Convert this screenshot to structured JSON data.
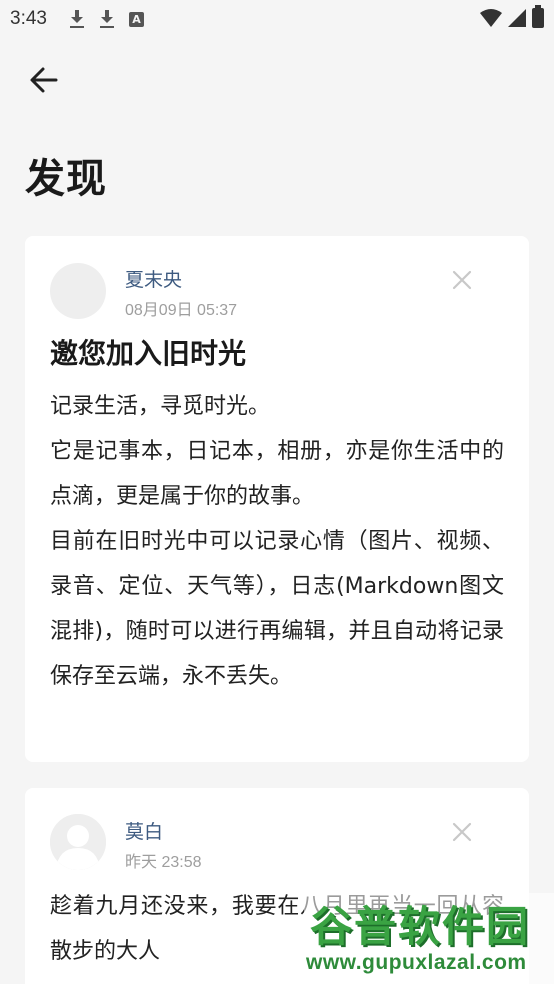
{
  "status_bar": {
    "time": "3:43",
    "left_icons": [
      "download-icon",
      "download-icon",
      "a-icon"
    ],
    "a_icon_letter": "A",
    "right_icons": [
      "wifi-icon",
      "signal-icon",
      "battery-icon"
    ]
  },
  "header": {
    "title": "发现"
  },
  "posts": [
    {
      "author": "夏末央",
      "date": "08月09日 05:37",
      "title": "邀您加入旧时光",
      "paragraphs": [
        "记录生活，寻觅时光。",
        "它是记事本，日记本，相册，亦是你生活中的点滴，更是属于你的故事。",
        "目前在旧时光中可以记录心情（图片、视频、录音、定位、天气等），日志(Markdown图文混排)，随时可以进行再编辑，并且自动将记录保存至云端，永不丢失。"
      ]
    },
    {
      "author": "莫白",
      "date": "昨天 23:58",
      "paragraphs": [
        "趁着九月还没来，我要在八月里再当一回从容散步的大人"
      ]
    }
  ],
  "watermark": {
    "brand": "谷普软件园",
    "url": "www.gupuxlazal.com"
  },
  "colors": {
    "background": "#f5f5f5",
    "card": "#ffffff",
    "author": "#3d5a80",
    "date": "#9e9e9e",
    "watermark_green": "#3aa343"
  }
}
